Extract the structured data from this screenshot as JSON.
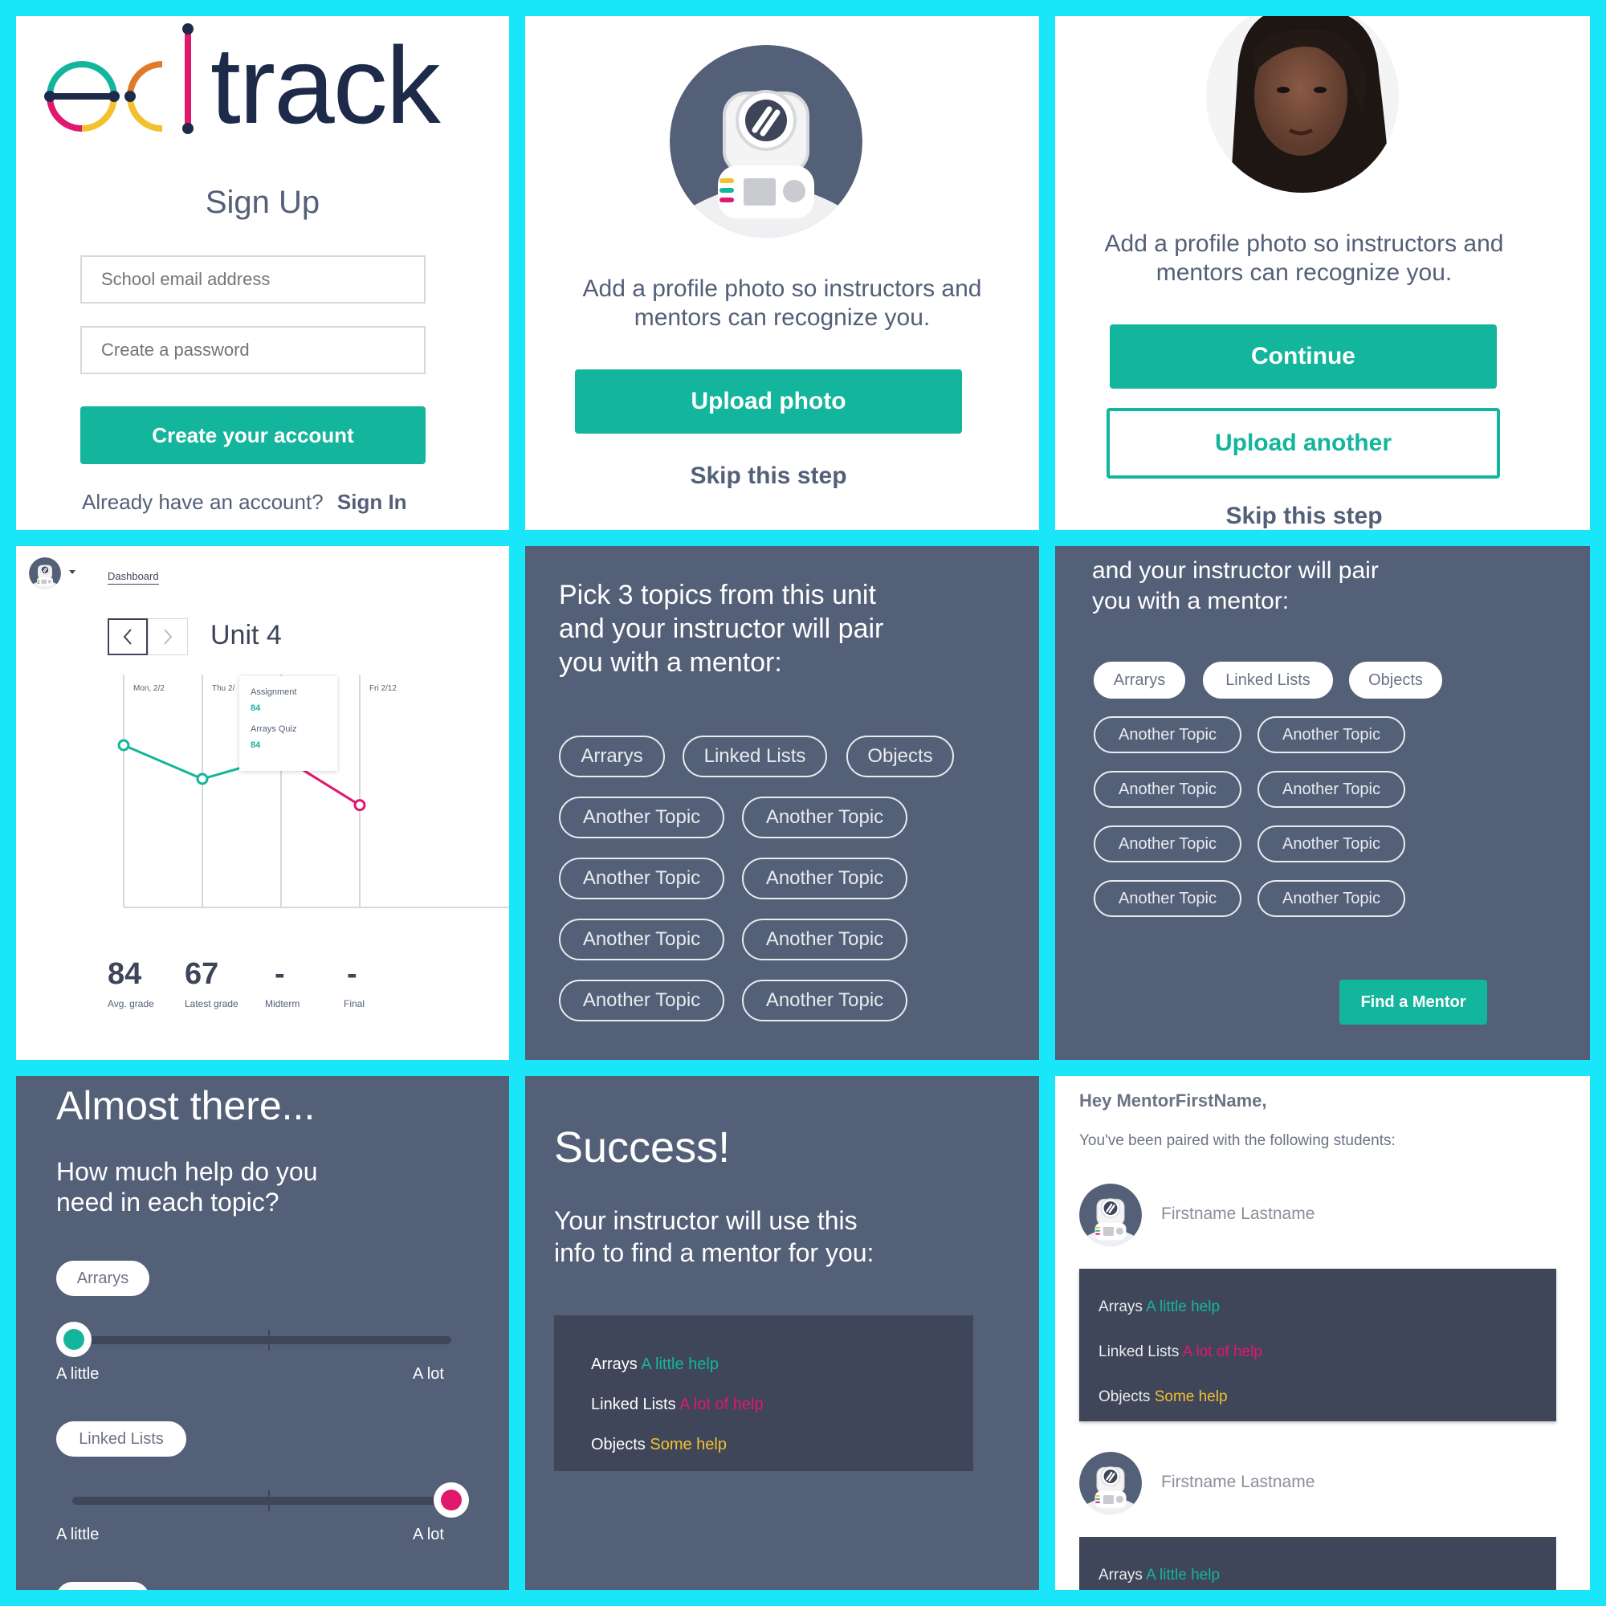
{
  "signup": {
    "logo_prefix": "ed",
    "logo_suffix": "track",
    "title": "Sign Up",
    "email_placeholder": "School email address",
    "password_placeholder": "Create a password",
    "create_button": "Create your account",
    "already_text": "Already have an account?",
    "signin_link": "Sign In"
  },
  "photo_step": {
    "message_line1": "Add a profile photo so instructors and",
    "message_line2": "mentors can recognize you.",
    "upload_button": "Upload photo",
    "skip_link": "Skip this step"
  },
  "photo_done": {
    "message_line1": "Add a profile photo so instructors and",
    "message_line2": "mentors can recognize you.",
    "continue_button": "Continue",
    "upload_another_button": "Upload another",
    "skip_link": "Skip this step"
  },
  "dashboard": {
    "nav_link": "Dashboard",
    "unit_title": "Unit 4",
    "dates": [
      "Mon, 2/2",
      "Thu 2/",
      "Fri 2/12"
    ],
    "tooltip": {
      "assignment_label": "Assignment",
      "assignment_value": "84",
      "quiz_label": "Arrays Quiz",
      "quiz_value": "84"
    },
    "stats": [
      {
        "value": "84",
        "label": "Avg. grade"
      },
      {
        "value": "67",
        "label": "Latest grade"
      },
      {
        "value": "-",
        "label": "Midterm"
      },
      {
        "value": "-",
        "label": "Final"
      }
    ]
  },
  "chart_data": {
    "type": "line",
    "x": [
      1,
      2,
      3,
      4
    ],
    "y": [
      84,
      75,
      81,
      68
    ],
    "series_colors": [
      "#13b59c",
      "#13b59c",
      "#e0186e"
    ]
  },
  "topics_pick": {
    "heading_line1": "Pick 3 topics from this unit",
    "heading_line2": "and your instructor will pair",
    "heading_line3": "you with a mentor:",
    "row1": [
      "Arrarys",
      "Linked Lists",
      "Objects"
    ],
    "more": [
      "Another Topic",
      "Another Topic",
      "Another Topic",
      "Another Topic",
      "Another Topic",
      "Another Topic",
      "Another Topic",
      "Another Topic"
    ]
  },
  "topics_selected": {
    "heading_line1": "and your instructor will pair",
    "heading_line2": "you with a mentor:",
    "selected": [
      "Arrarys",
      "Linked Lists",
      "Objects"
    ],
    "more": [
      "Another Topic",
      "Another Topic",
      "Another Topic",
      "Another Topic",
      "Another Topic",
      "Another Topic",
      "Another Topic",
      "Another Topic"
    ],
    "find_button": "Find a Mentor"
  },
  "almost": {
    "title": "Almost there...",
    "question_line1": "How much help do you",
    "question_line2": "need in each topic?",
    "topic1": "Arrarys",
    "topic1_level": 0,
    "topic2": "Linked Lists",
    "topic2_level": 1,
    "min_label": "A little",
    "max_label": "A lot"
  },
  "success": {
    "title": "Success!",
    "line1": "Your instructor will use this",
    "line2": "info to find a mentor for you:",
    "items": [
      {
        "topic": "Arrays",
        "help": "A little help"
      },
      {
        "topic": "Linked Lists",
        "help": "A lot of help"
      },
      {
        "topic": "Objects",
        "help": "Some help"
      }
    ]
  },
  "mentor_email": {
    "greeting": "Hey MentorFirstName,",
    "intro": "You've been paired with the following students:",
    "student1_name": "Firstname Lastname",
    "student1_items": [
      {
        "topic": "Arrays",
        "help": "A little help"
      },
      {
        "topic": "Linked Lists",
        "help": "A lot of help"
      },
      {
        "topic": "Objects",
        "help": "Some help"
      }
    ],
    "student2_name": "Firstname Lastname",
    "student2_items": [
      {
        "topic": "Arrays",
        "help": "A little help"
      }
    ]
  },
  "colors": {
    "teal": "#13b59c",
    "pink": "#e0186e",
    "yellow": "#f2c12e",
    "slate": "#546078",
    "navy": "#1d2a4a",
    "frame": "#1ae6fa"
  }
}
